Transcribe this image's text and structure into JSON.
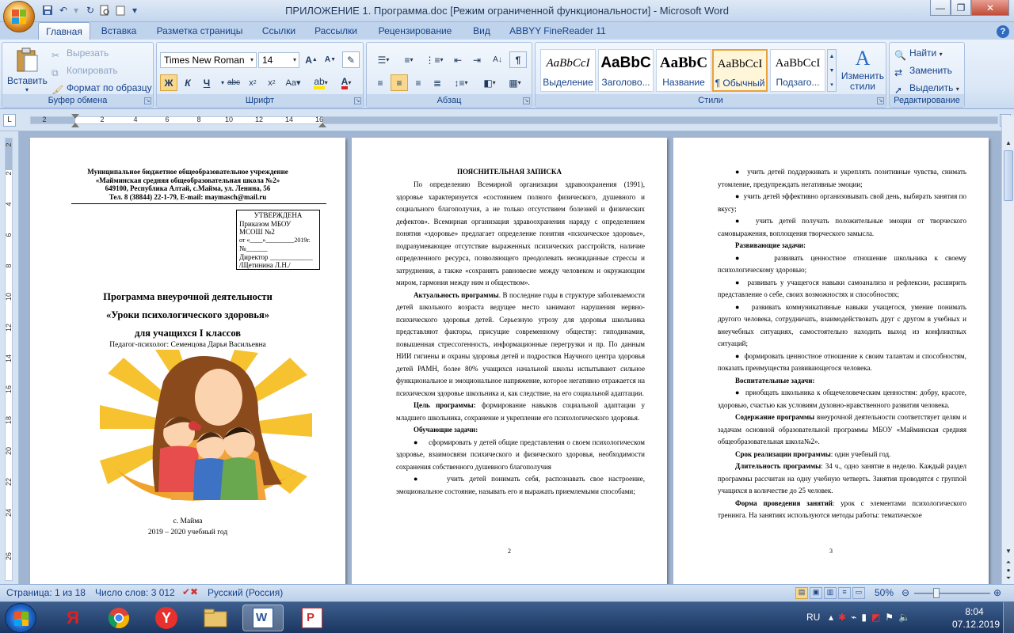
{
  "window": {
    "title": "ПРИЛОЖЕНИЕ 1. Программа.doc [Режим ограниченной функциональности] - Microsoft Word"
  },
  "tabs": [
    "Главная",
    "Вставка",
    "Разметка страницы",
    "Ссылки",
    "Рассылки",
    "Рецензирование",
    "Вид",
    "ABBYY FineReader 11"
  ],
  "ribbon": {
    "clipboard": {
      "paste": "Вставить",
      "cut": "Вырезать",
      "copy": "Копировать",
      "format_painter": "Формат по образцу",
      "label": "Буфер обмена"
    },
    "font": {
      "font_name": "Times New Roman",
      "font_size": "14",
      "label": "Шрифт"
    },
    "paragraph": {
      "label": "Абзац"
    },
    "styles": {
      "label": "Стили",
      "items": [
        {
          "sample": "AaBbCcI",
          "name": "Выделение"
        },
        {
          "sample": "AaBbC",
          "name": "Заголово..."
        },
        {
          "sample": "AaBbC",
          "name": "Название"
        },
        {
          "sample": "AaBbCcI",
          "name": "¶ Обычный"
        },
        {
          "sample": "AaBbCcI",
          "name": "Подзаго..."
        }
      ],
      "change_styles": "Изменить стили"
    },
    "editing": {
      "find": "Найти",
      "replace": "Заменить",
      "select": "Выделить",
      "label": "Редактирование"
    }
  },
  "ruler": {
    "numbers": [
      "2",
      "2",
      "4",
      "6",
      "8",
      "10",
      "12",
      "14",
      "16"
    ],
    "vnumbers": [
      "2",
      "2",
      "4",
      "6",
      "8",
      "10",
      "12",
      "14",
      "16",
      "18",
      "20",
      "22",
      "24",
      "26"
    ]
  },
  "page1": {
    "header1": "Муниципальное бюджетное общеобразовательное учреждение",
    "header2": "«Майминская средняя общеобразовательная школа №2»",
    "header3": "649100, Республика Алтай, с.Майма, ул. Ленина, 56",
    "header4": "Тел. 8 (38844) 22-1-79, E-mail: maymasch@mail.ru",
    "approve": [
      "УТВЕРЖДЕНА",
      "Приказом МБОУ",
      "МСОШ №2",
      "от «____»_________2019г.",
      "№______",
      "Директор ____________",
      "/Щетинина Л.Н./"
    ],
    "title1": "Программа внеурочной деятельности",
    "title2": "«Уроки психологического здоровья»",
    "title3": "для учащихся I классов",
    "author": "Педагог-психолог: Семенцова Дарья Васильевна",
    "place": "с. Майма",
    "year": "2019 – 2020 учебный год"
  },
  "page2": {
    "heading": "ПОЯСНИТЕЛЬНАЯ ЗАПИСКА",
    "par1": "По определению Всемирной организации здравоохранения (1991), здоровье характеризуется «состоянием полного физического, душевного и социального благополучия, а не только отсутствием болезней и физических дефектов». Всемирная организация здравоохранения наряду с определением понятия «здоровье» предлагает определение понятия «психическое здоровье», подразумевающее отсутствие выраженных психических расстройств, наличие определенного ресурса, позволяющего преодолевать неожиданные стрессы и затруднения, а также «сохранять равновесие между человеком и окружающим миром, гармония между ним и обществом».",
    "par2_bold": "Актуальность программы",
    "par2": ". В последние годы в структуре заболеваемости детей школьного возраста ведущее место занимают нарушения нервно-психического здоровья детей. Серьезную угрозу для здоровья школьника представляют факторы, присущие современному обществу: гиподинамия, повышенная стрессогенность, информационные перегрузки и пр. По данным НИИ гигиены и охраны здоровья детей и подростков Научного центра здоровья детей РАМН, более 80% учащихся начальной школы испытывают сильное функциональное и эмоциональное напряжение, которое негативно отражается на психическом здоровье школьника и, как следствие, на его социальной адаптации.",
    "par3_bold": "Цель программы:",
    "par3": " формирование навыков социальной адаптации у младшего школьника, сохранение и укрепление его психологического здоровья.",
    "tasks_heading": "Обучающие задачи:",
    "bullet1": "сформировать у детей общие представления о своем психологическом здоровье, взаимосвязи психического и физического здоровья, необходимости сохранения собственного душевного благополучия",
    "bullet2": "учить детей понимать себя, распознавать свое настроение, эмоциональное состояние, называть его и выражать приемлемыми способами;",
    "page_num": "2"
  },
  "page3": {
    "b1": "учить детей поддерживать и укреплять позитивные чувства, снимать утомление, предупреждать негативные эмоции;",
    "b2": "учить детей эффективно организовывать свой день, выбирать занятия по вкусу;",
    "b3": "учить детей получать положительные эмоции от творческого самовыражения, воплощения творческого замысла.",
    "dev_heading": "Развивающие задачи:",
    "b4": "развивать ценностное отношение школьника к своему психологическому здоровью;",
    "b5": "развивать у учащегося навыки самоанализа и рефлексии, расширить представление о себе, своих возможностях и способностях;",
    "b6": "развивать коммуникативные навыки учащегося, умение понимать другого человека, сотрудничать, взаимодействовать друг с другом в учебных и внеучебных ситуациях, самостоятельно находить выход из конфликтных ситуаций;",
    "b7": "формировать ценностное отношение к своим талантам и способностям, показать преимущества развивающегося человека.",
    "edu_heading": "Воспитательные задачи:",
    "b8": "приобщать школьника к общечеловеческим ценностям: добру, красоте, здоровью, счастью как условиям духовно-нравственного развития человека.",
    "content_bold": "Содержание программы",
    "content": " внеурочной деятельности соответствует целям и задачам основной образовательной программы МБОУ «Майминская средняя общеобразовательная школа№2».",
    "term_bold": "Срок реализации программы",
    "term": ": один учебный год.",
    "dur_bold": "Длительность программы",
    "dur": ": 34 ч., одно занятие в неделю. Каждый раздел программы рассчитан на одну учебную четверть. Занятия проводятся с группой учащихся в количестве до 25 человек.",
    "form_bold": "Форма проведения занятий",
    "form": ": урок с элементами психологического тренинга. На занятиях используются методы работы: тематическое",
    "page_num": "3"
  },
  "status": {
    "page": "Страница: 1 из 18",
    "words": "Число слов: 3 012",
    "lang": "Русский (Россия)",
    "zoom": "50%"
  },
  "taskbar": {
    "lang": "RU",
    "time": "8:04",
    "date": "07.12.2019"
  }
}
